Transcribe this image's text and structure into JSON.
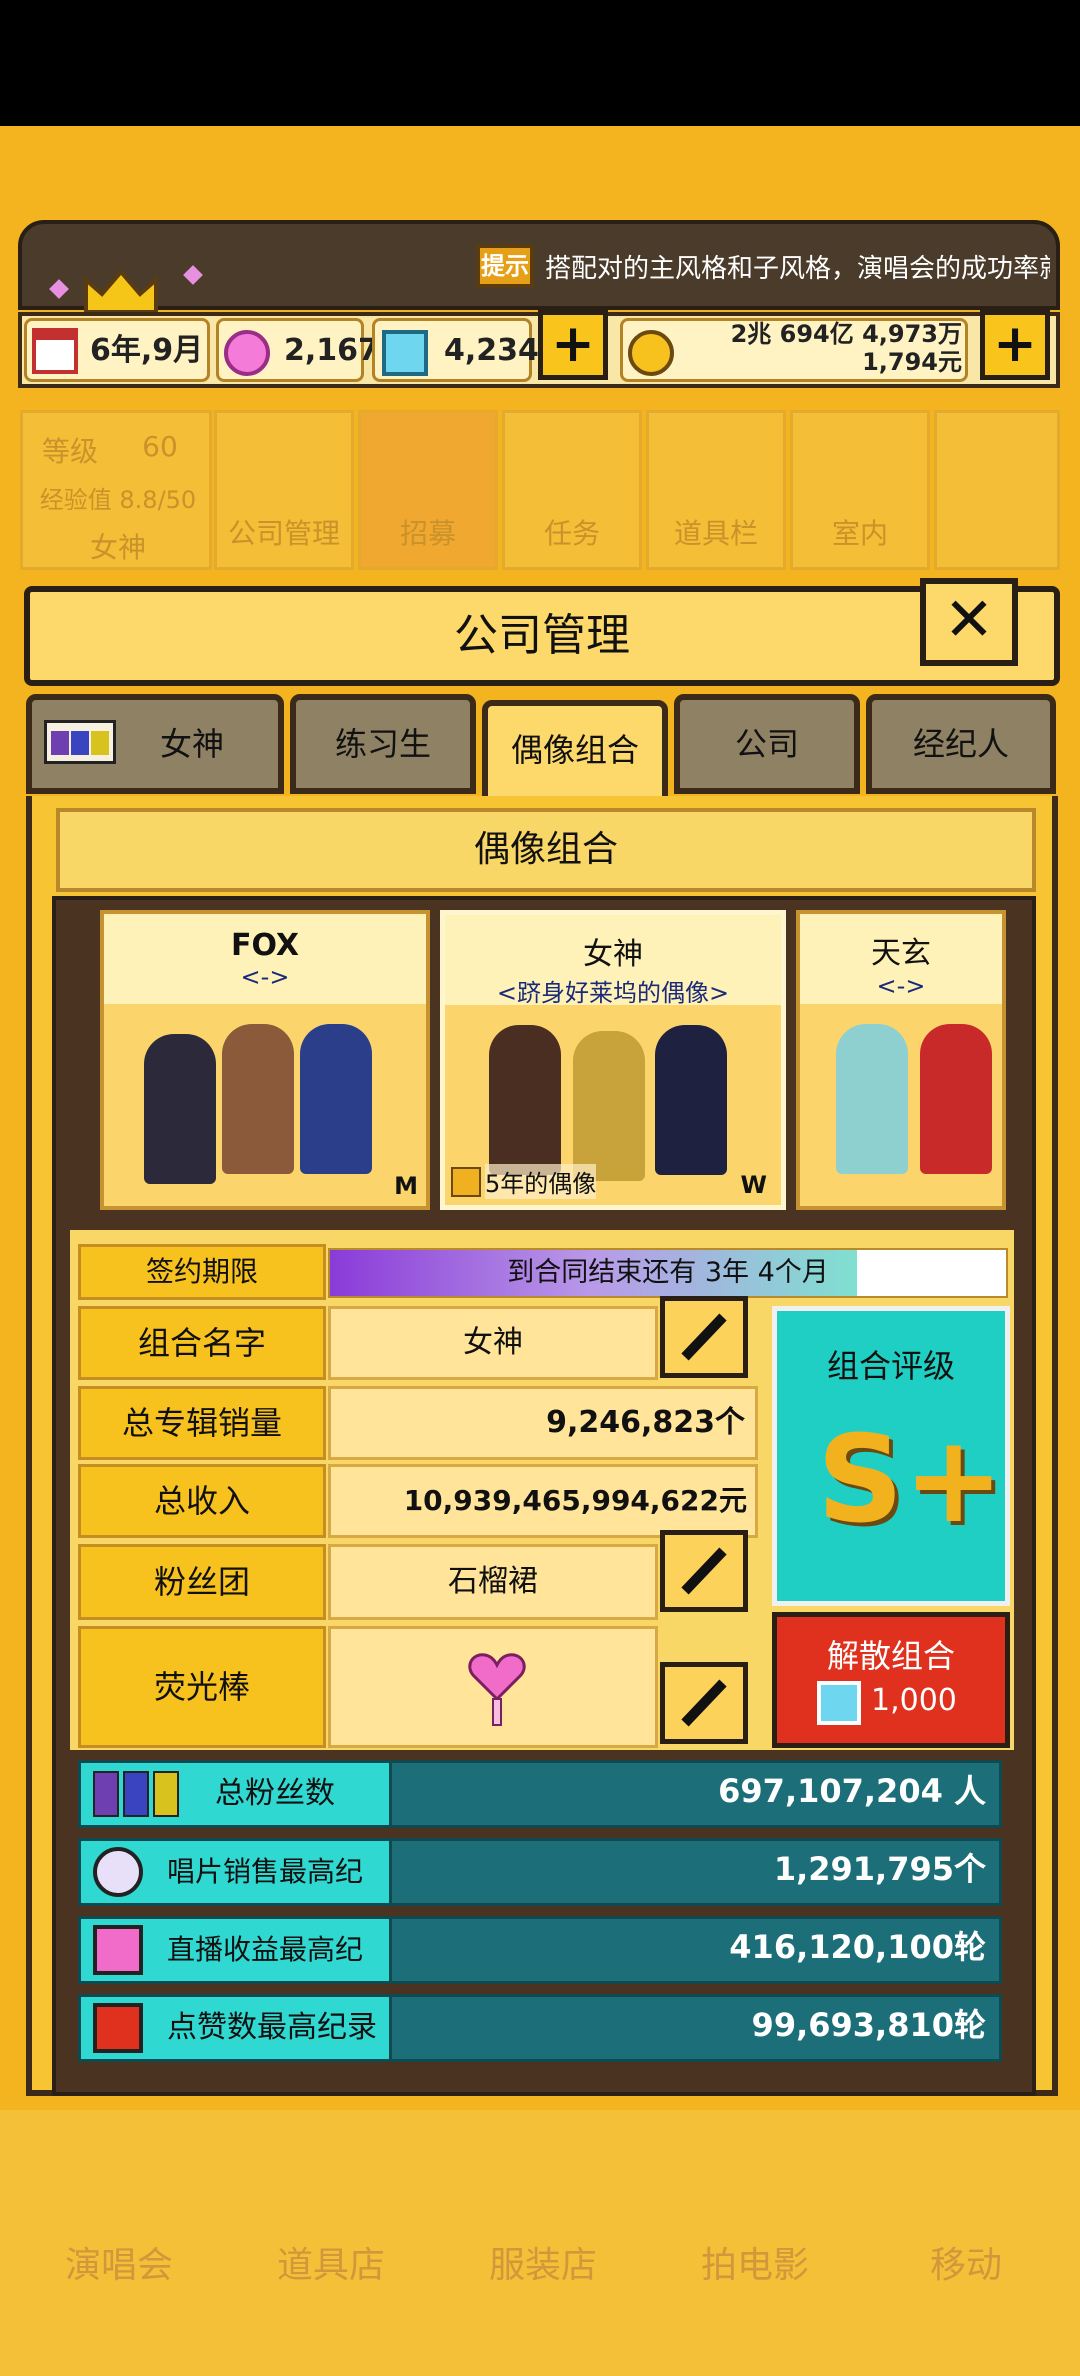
{
  "tip": {
    "icon_label": "提示",
    "text": "搭配对的主风格和子风格，演唱会的成功率就"
  },
  "resources": {
    "date": "6年,9月",
    "pink_gems": "2,167",
    "diamonds": "4,234",
    "money_line1": "2兆 694亿 4,973万",
    "money_line2": "1,794元",
    "plus": "+"
  },
  "faded_nav": {
    "level_label": "等级",
    "level_value": "60",
    "exp": "经验值 8.8/50",
    "name": "女神",
    "items": [
      "公司管理",
      "招募",
      "任务",
      "道具栏",
      "室内"
    ]
  },
  "panel": {
    "title": "公司管理",
    "close": "✕"
  },
  "tabs": [
    "女神",
    "练习生",
    "偶像组合",
    "公司",
    "经纪人"
  ],
  "section_title": "偶像组合",
  "groups": [
    {
      "name": "FOX",
      "sub": "<->",
      "badge": "M"
    },
    {
      "name": "女神",
      "sub": "<跻身好莱坞的偶像>",
      "badge": "W",
      "years": "5年的偶像"
    },
    {
      "name": "天玄",
      "sub": "<->"
    }
  ],
  "contract": {
    "label": "签约期限",
    "text": "到合同结束还有 3年 4个月",
    "progress": 0.78
  },
  "fields": {
    "group_name_label": "组合名字",
    "group_name": "女神",
    "album_label": "总专辑销量",
    "album": "9,246,823个",
    "income_label": "总收入",
    "income": "10,939,465,994,622元",
    "fanclub_label": "粉丝团",
    "fanclub": "石榴裙",
    "lightstick_label": "荧光棒"
  },
  "rating": {
    "label": "组合评级",
    "grade": "S+"
  },
  "disband": {
    "label": "解散组合",
    "cost": "1,000"
  },
  "stats": [
    {
      "label": "总粉丝数",
      "value": "697,107,204 人",
      "icon": "fans-icon"
    },
    {
      "label": "唱片销售最高纪录",
      "value": "1,291,795个",
      "icon": "disc-icon"
    },
    {
      "label": "直播收益最高纪录",
      "value": "416,120,100轮",
      "icon": "music-note-icon"
    },
    {
      "label": "点赞数最高纪录",
      "value": "99,693,810轮",
      "icon": "play-icon"
    }
  ],
  "bottom_nav": [
    "演唱会",
    "道具店",
    "服装店",
    "拍电影",
    "移动"
  ],
  "colors": {
    "accent": "#F3B41F",
    "teal": "#1C6E78",
    "cyan": "#2FD8D0",
    "red": "#E0301E"
  }
}
